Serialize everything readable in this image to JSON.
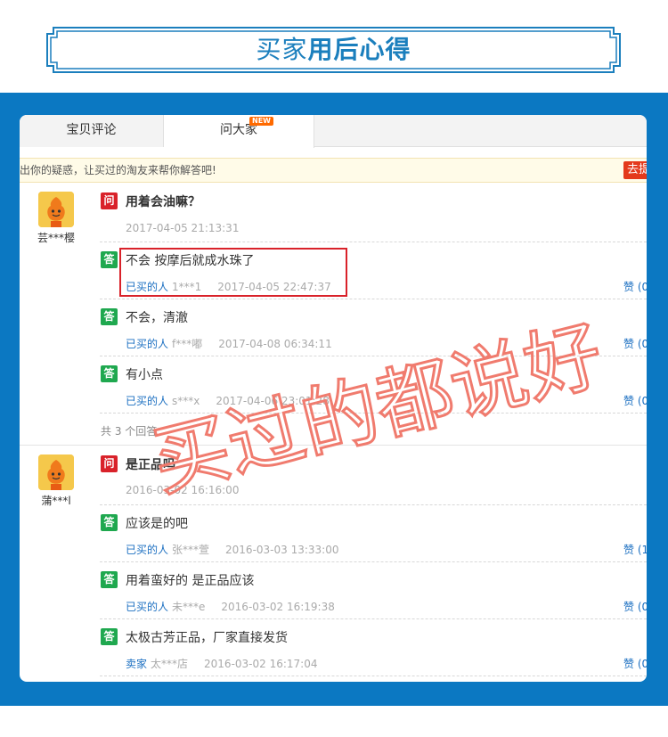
{
  "banner": {
    "title_normal": "买家",
    "title_bold": "用后心得"
  },
  "tabs": {
    "reviews": "宝贝评论",
    "ask": "问大家",
    "new_badge": "NEW"
  },
  "notice": {
    "text": "出你的疑惑，让买过的淘友来帮你解答吧!",
    "button": "去提"
  },
  "threads": [
    {
      "asker": "芸***樱",
      "question": {
        "icon": "问",
        "text": "用着会油嘛？",
        "time": "2017-04-05 21:13:31"
      },
      "answers": [
        {
          "icon": "答",
          "text": "不会 按摩后就成水珠了",
          "role": "已买的人",
          "user": "1***1",
          "time": "2017-04-05 22:47:37",
          "like": "赞 (0"
        },
        {
          "icon": "答",
          "text": "不会，清澈",
          "role": "已买的人",
          "user": "f***嘟",
          "time": "2017-04-08 06:34:11",
          "like": "赞 (0"
        },
        {
          "icon": "答",
          "text": "有小点",
          "role": "已买的人",
          "user": "s***x",
          "time": "2017-04-06 23:01:28",
          "like": "赞 (0"
        }
      ],
      "count": "共 3 个回答"
    },
    {
      "asker": "蒲***l",
      "question": {
        "icon": "问",
        "text": "是正品吗",
        "time": "2016-03-02 16:16:00"
      },
      "answers": [
        {
          "icon": "答",
          "text": "应该是的吧",
          "role": "已买的人",
          "user": "张***萱",
          "time": "2016-03-03 13:33:00",
          "like": "赞 (1"
        },
        {
          "icon": "答",
          "text": "用着蛮好的 是正品应该",
          "role": "已买的人",
          "user": "未***e",
          "time": "2016-03-02 16:19:38",
          "like": "赞 (0"
        },
        {
          "icon": "答",
          "text": "太极古芳正品，厂家直接发货",
          "role": "卖家",
          "user": "太***店",
          "time": "2016-03-02 16:17:04",
          "like": "赞 (0"
        }
      ]
    }
  ],
  "watermark": {
    "text": "买过的都说好"
  },
  "colors": {
    "brand_blue": "#0b78c2",
    "title_blue": "#1b7fbd",
    "question_red": "#d9222a",
    "answer_green": "#1fa84f",
    "link_blue": "#1b6fc1",
    "watermark": "#f07b6e"
  }
}
